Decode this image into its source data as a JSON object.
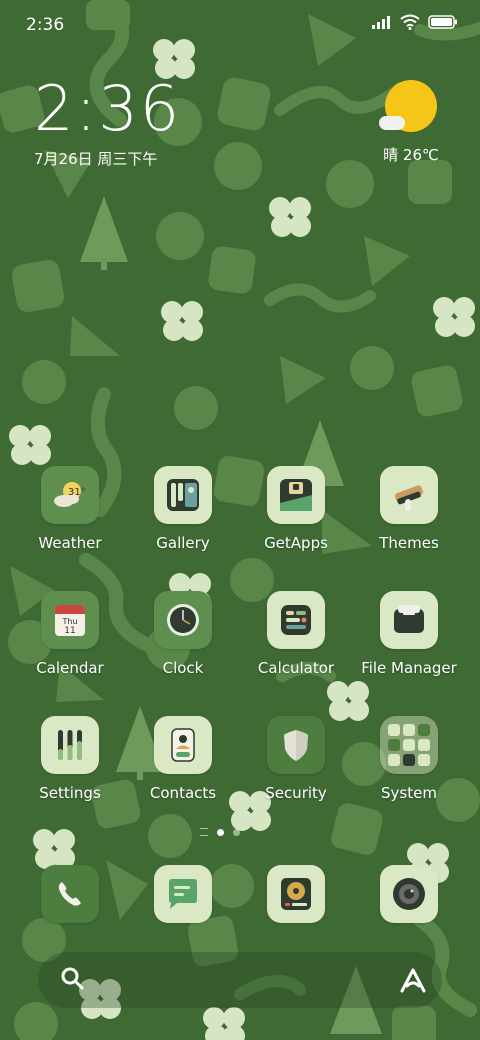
{
  "status_bar": {
    "time": "2:36",
    "signal_icon": "signal-icon",
    "wifi_icon": "wifi-icon",
    "battery_icon": "battery-icon"
  },
  "clock_widget": {
    "time": "2:36",
    "date": "7月26日 周三下午"
  },
  "weather_widget": {
    "text": "晴 26℃",
    "icon": "sunny-partly-cloudy-icon"
  },
  "apps": [
    {
      "label": "Weather",
      "icon": "weather-icon",
      "badge": "31°"
    },
    {
      "label": "Gallery",
      "icon": "gallery-icon"
    },
    {
      "label": "GetApps",
      "icon": "getapps-icon"
    },
    {
      "label": "Themes",
      "icon": "themes-icon"
    },
    {
      "label": "Calendar",
      "icon": "calendar-icon",
      "day": "Thu",
      "date": "11"
    },
    {
      "label": "Clock",
      "icon": "clock-icon"
    },
    {
      "label": "Calculator",
      "icon": "calculator-icon"
    },
    {
      "label": "File Manager",
      "icon": "file-manager-icon"
    },
    {
      "label": "Settings",
      "icon": "settings-icon"
    },
    {
      "label": "Contacts",
      "icon": "contacts-icon"
    },
    {
      "label": "Security",
      "icon": "security-icon"
    },
    {
      "label": "System",
      "icon": "system-folder-icon"
    }
  ],
  "dock": [
    {
      "icon": "phone-icon"
    },
    {
      "icon": "messages-icon"
    },
    {
      "icon": "music-icon"
    },
    {
      "icon": "camera-icon"
    }
  ],
  "search_bar": {
    "search_icon": "search-icon",
    "assistant_icon": "assistant-icon"
  },
  "colors": {
    "wallpaper": "#3f6a34",
    "pattern": "#5f8a4e",
    "pattern_light": "#d8e9c4",
    "tile_light": "#dde9c7",
    "tile_dark": "#4d7d3f",
    "sun": "#f5c518"
  }
}
